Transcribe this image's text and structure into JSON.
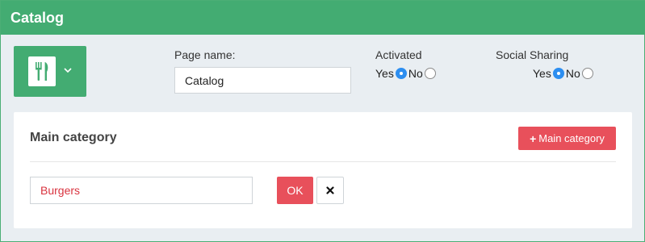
{
  "window": {
    "title": "Catalog"
  },
  "icon_picker": {
    "icon": "utensils-icon",
    "dropdown_icon": "chevron-down-icon"
  },
  "page_name": {
    "label": "Page name:",
    "value": "Catalog"
  },
  "activated": {
    "label": "Activated",
    "yes_label": "Yes",
    "no_label": "No",
    "selected": "Yes"
  },
  "social_sharing": {
    "label": "Social Sharing",
    "yes_label": "Yes",
    "no_label": "No",
    "selected": "Yes"
  },
  "main_category": {
    "heading": "Main category",
    "add_button_label": "Main category",
    "add_button_icon": "plus-icon",
    "input_value": "Burgers",
    "ok_label": "OK",
    "cancel_icon": "close-icon"
  },
  "colors": {
    "brand_green": "#43ac72",
    "accent_red": "#e8505b",
    "radio_blue": "#2d8ef0"
  }
}
